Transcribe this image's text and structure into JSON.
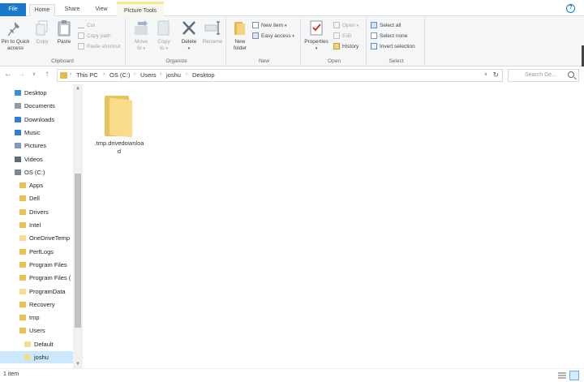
{
  "tabs": {
    "file": "File",
    "home": "Home",
    "share": "Share",
    "view": "View",
    "picture_tools": "Picture Tools"
  },
  "ribbon": {
    "clipboard": {
      "label": "Clipboard",
      "pin_to_quick_access_line1": "Pin to Quick",
      "pin_to_quick_access_line2": "access",
      "copy": "Copy",
      "paste": "Paste",
      "cut": "Cut",
      "copy_path": "Copy path",
      "paste_shortcut": "Paste shortcut"
    },
    "organize": {
      "label": "Organize",
      "move_to_line1": "Move",
      "move_to_line2": "to",
      "copy_to_line1": "Copy",
      "copy_to_line2": "to",
      "delete": "Delete",
      "rename": "Rename"
    },
    "new": {
      "label": "New",
      "new_folder_line1": "New",
      "new_folder_line2": "folder",
      "new_item": "New item",
      "easy_access": "Easy access"
    },
    "open": {
      "label": "Open",
      "properties": "Properties",
      "open": "Open",
      "edit": "Edit",
      "history": "History"
    },
    "select": {
      "label": "Select",
      "select_all": "Select all",
      "select_none": "Select none",
      "invert_selection": "Invert selection"
    }
  },
  "address": {
    "crumbs": [
      "This PC",
      "OS (C:)",
      "Users",
      "joshu",
      "Desktop"
    ],
    "search_placeholder": "Search De..."
  },
  "navpane": {
    "items": [
      {
        "label": "Desktop",
        "icon": "desktop-icon"
      },
      {
        "label": "Documents",
        "icon": "documents-icon"
      },
      {
        "label": "Downloads",
        "icon": "downloads-icon"
      },
      {
        "label": "Music",
        "icon": "music-icon"
      },
      {
        "label": "Pictures",
        "icon": "pictures-icon"
      },
      {
        "label": "Videos",
        "icon": "videos-icon"
      },
      {
        "label": "OS (C:)",
        "icon": "drive-icon"
      },
      {
        "label": "Apps",
        "icon": "folder-icon"
      },
      {
        "label": "Dell",
        "icon": "folder-icon"
      },
      {
        "label": "Drivers",
        "icon": "folder-icon"
      },
      {
        "label": "Intel",
        "icon": "folder-icon"
      },
      {
        "label": "OneDriveTemp",
        "icon": "folder-icon"
      },
      {
        "label": "PerfLogs",
        "icon": "folder-icon"
      },
      {
        "label": "Program Files",
        "icon": "folder-icon"
      },
      {
        "label": "Program Files (",
        "icon": "folder-icon"
      },
      {
        "label": "ProgramData",
        "icon": "folder-icon"
      },
      {
        "label": "Recovery",
        "icon": "folder-icon"
      },
      {
        "label": "tmp",
        "icon": "folder-icon"
      },
      {
        "label": "Users",
        "icon": "folder-icon"
      },
      {
        "label": "Default",
        "icon": "folder-icon"
      },
      {
        "label": "joshu",
        "icon": "folder-icon"
      }
    ]
  },
  "content": {
    "files": [
      {
        "name": ".tmp.drivedownload",
        "icon": "folder-icon"
      }
    ]
  },
  "status": {
    "item_count": "1 item"
  },
  "colors": {
    "accent": "#1979ca",
    "folder": "#f8dc8c",
    "selection": "#cce8ff"
  }
}
